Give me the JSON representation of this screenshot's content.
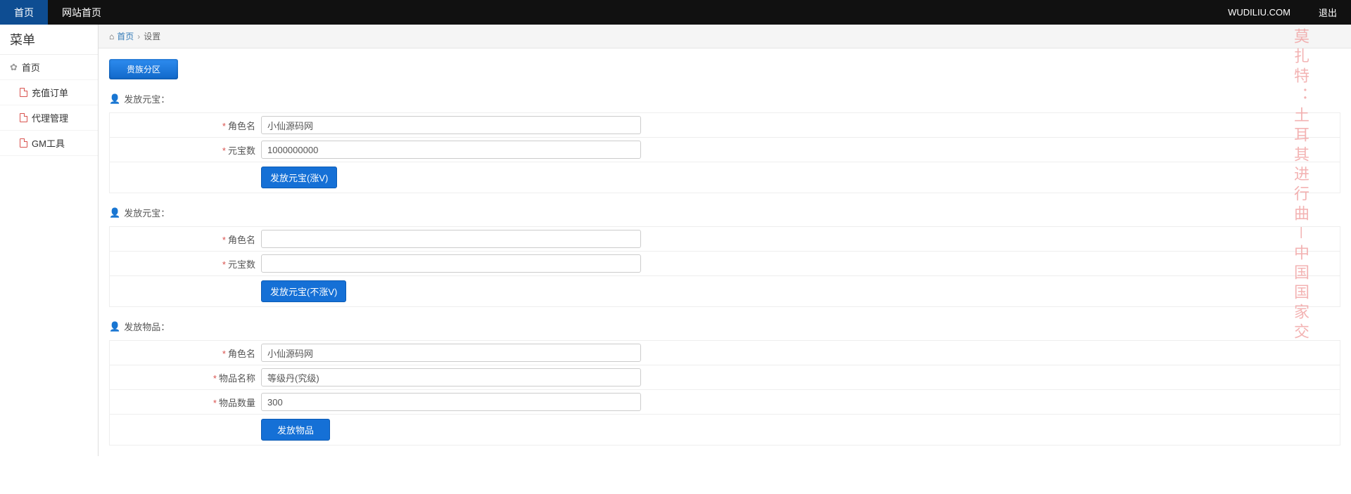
{
  "nav": {
    "home": "首页",
    "site": "网站首页",
    "brand": "WUDILIU.COM",
    "logout": "退出"
  },
  "sidebar": {
    "title": "菜单",
    "home": "首页",
    "items": [
      "充值订单",
      "代理管理",
      "GM工具"
    ]
  },
  "breadcrumb": {
    "home": "首页",
    "current": "设置"
  },
  "zoneButton": "贵族分区",
  "sections": {
    "s1": {
      "title": "发放元宝：",
      "label1": "角色名",
      "value1": "小仙源码网",
      "label2": "元宝数",
      "value2": "1000000000",
      "button": "发放元宝(涨V)"
    },
    "s2": {
      "title": "发放元宝：",
      "label1": "角色名",
      "value1": "",
      "label2": "元宝数",
      "value2": "",
      "button": "发放元宝(不涨V)"
    },
    "s3": {
      "title": "发放物品：",
      "label1": "角色名",
      "value1": "小仙源码网",
      "label2": "物品名称",
      "value2": "等级丹(究级)",
      "label3": "物品数量",
      "value3": "300",
      "button": "发放物品"
    }
  },
  "watermark": "莫扎特：土耳其进行曲－中国国家交"
}
